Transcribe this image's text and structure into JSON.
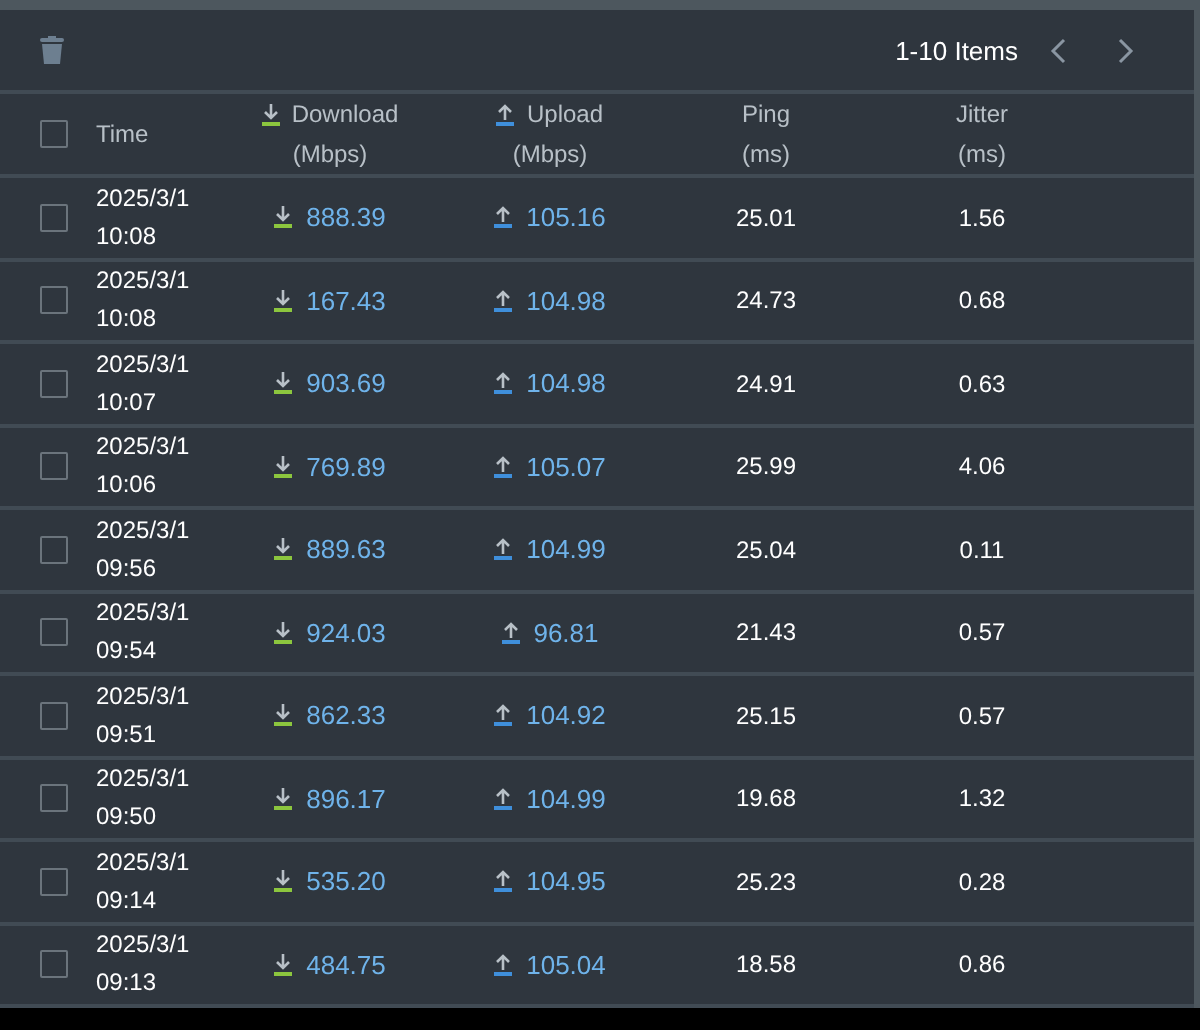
{
  "toolbar": {
    "pagination": "1-10 Items"
  },
  "table": {
    "header_checked": false,
    "columns": [
      {
        "kind": "time",
        "label": "Time"
      },
      {
        "kind": "download",
        "label": "Download",
        "unit": "(Mbps)"
      },
      {
        "kind": "upload",
        "label": "Upload",
        "unit": "(Mbps)"
      },
      {
        "kind": "plain",
        "label": "Ping",
        "unit": "(ms)"
      },
      {
        "kind": "plain",
        "label": "Jitter",
        "unit": "(ms)"
      }
    ],
    "rows": [
      {
        "checked": false,
        "date": "2025/3/1",
        "time": "10:08",
        "download": "888.39",
        "upload": "105.16",
        "ping": "25.01",
        "jitter": "1.56"
      },
      {
        "checked": false,
        "date": "2025/3/1",
        "time": "10:08",
        "download": "167.43",
        "upload": "104.98",
        "ping": "24.73",
        "jitter": "0.68"
      },
      {
        "checked": false,
        "date": "2025/3/1",
        "time": "10:07",
        "download": "903.69",
        "upload": "104.98",
        "ping": "24.91",
        "jitter": "0.63"
      },
      {
        "checked": false,
        "date": "2025/3/1",
        "time": "10:06",
        "download": "769.89",
        "upload": "105.07",
        "ping": "25.99",
        "jitter": "4.06"
      },
      {
        "checked": false,
        "date": "2025/3/1",
        "time": "09:56",
        "download": "889.63",
        "upload": "104.99",
        "ping": "25.04",
        "jitter": "0.11"
      },
      {
        "checked": false,
        "date": "2025/3/1",
        "time": "09:54",
        "download": "924.03",
        "upload": "96.81",
        "ping": "21.43",
        "jitter": "0.57"
      },
      {
        "checked": false,
        "date": "2025/3/1",
        "time": "09:51",
        "download": "862.33",
        "upload": "104.92",
        "ping": "25.15",
        "jitter": "0.57"
      },
      {
        "checked": false,
        "date": "2025/3/1",
        "time": "09:50",
        "download": "896.17",
        "upload": "104.99",
        "ping": "19.68",
        "jitter": "1.32"
      },
      {
        "checked": false,
        "date": "2025/3/1",
        "time": "09:14",
        "download": "535.20",
        "upload": "104.95",
        "ping": "25.23",
        "jitter": "0.28"
      },
      {
        "checked": false,
        "date": "2025/3/1",
        "time": "09:13",
        "download": "484.75",
        "upload": "105.04",
        "ping": "18.58",
        "jitter": "0.86"
      }
    ]
  }
}
